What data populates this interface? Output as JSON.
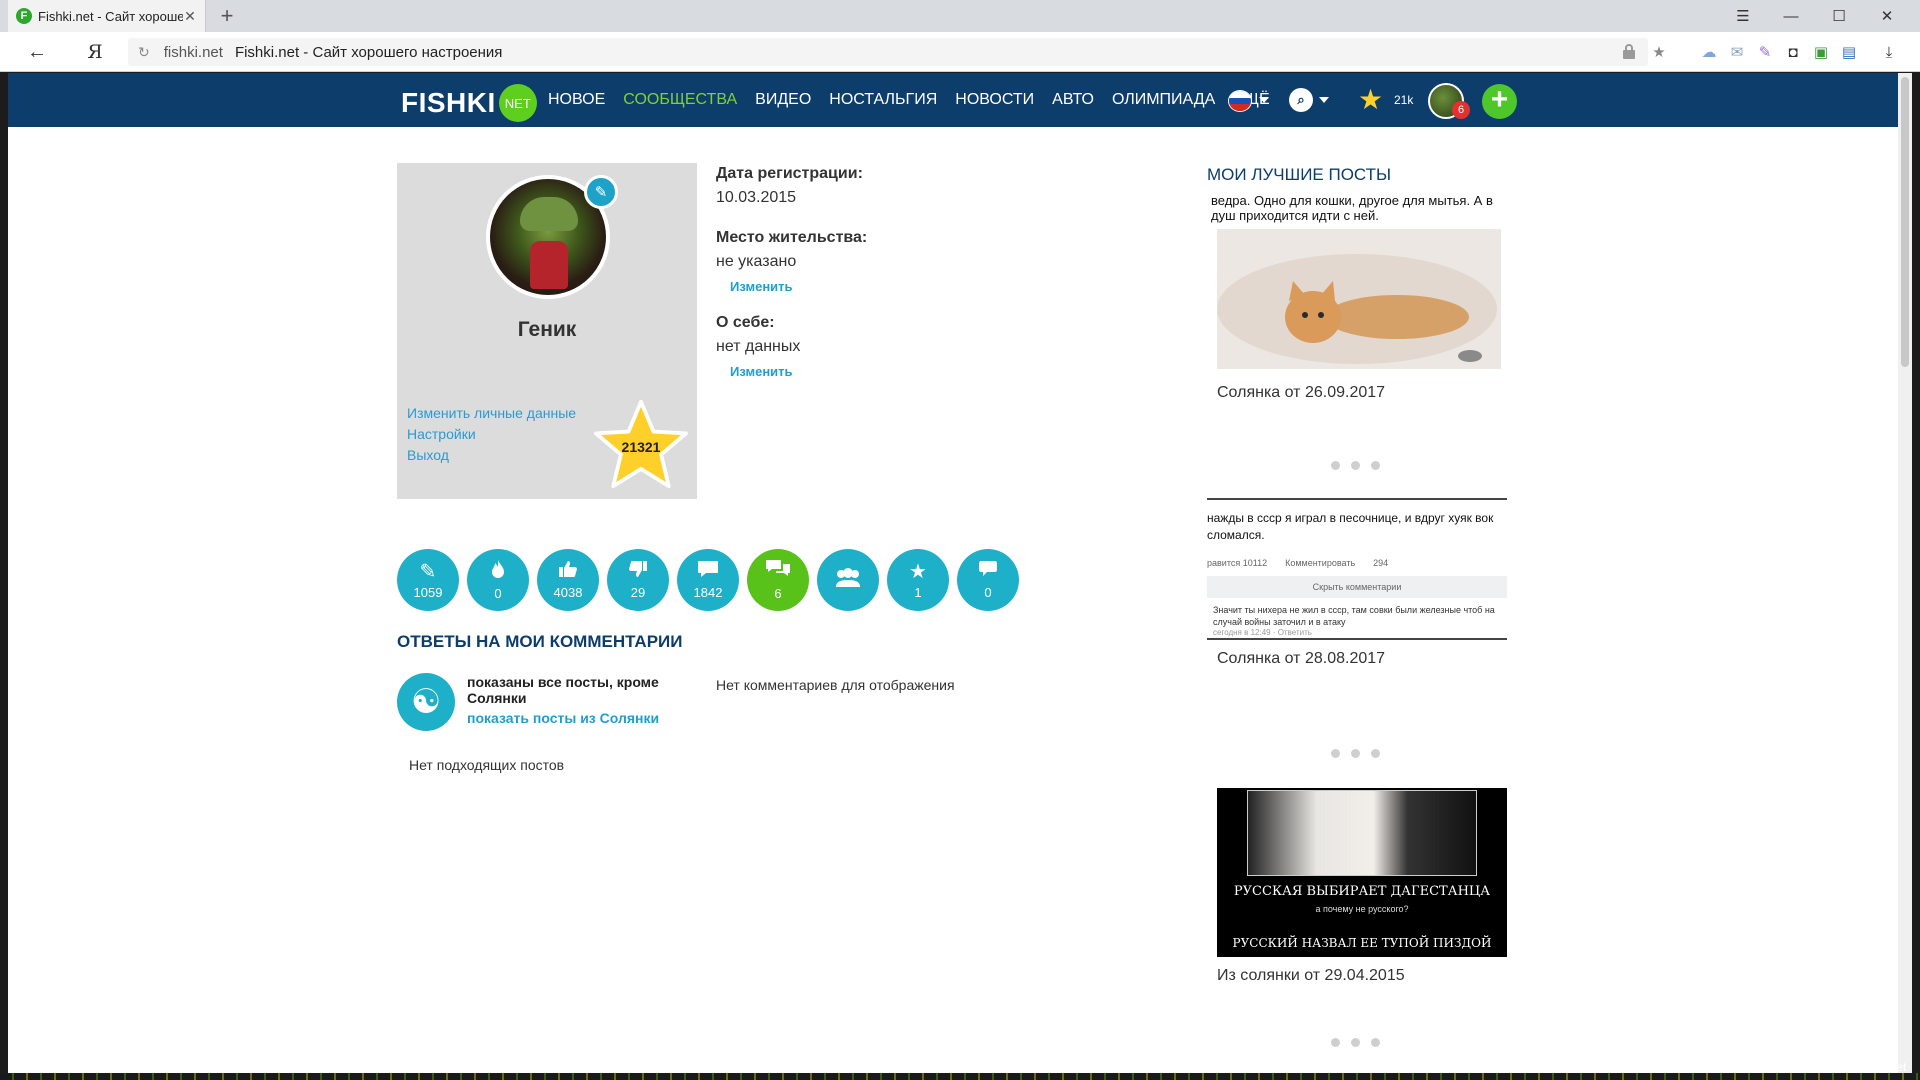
{
  "browser": {
    "tab_title": "Fishki.net - Сайт хорошего настроения",
    "tab_favicon": "F",
    "tab_close": "✕",
    "new_tab": "+",
    "window_controls": [
      "☰",
      "—",
      "☐",
      "✕"
    ],
    "back": "←",
    "yandex_logo": "Я",
    "reload": "↻",
    "url_host": "fishki.net",
    "url_title": "Fishki.net - Сайт хорошего настроения",
    "icons": [
      "lock-icon",
      "star-bookmark-icon",
      "cloud-icon",
      "mail-icon",
      "pen-icon",
      "pocket-icon",
      "counter-icon",
      "translate-icon",
      "download-icon"
    ]
  },
  "site": {
    "logo": "FISHKI",
    "logo_badge": "NET",
    "menu": [
      {
        "label": "НОВОЕ",
        "active": false
      },
      {
        "label": "СООБЩЕСТВА",
        "active": true
      },
      {
        "label": "ВИДЕО",
        "active": false
      },
      {
        "label": "НОСТАЛЬГИЯ",
        "active": false
      },
      {
        "label": "НОВОСТИ",
        "active": false
      },
      {
        "label": "АВТО",
        "active": false
      },
      {
        "label": "ОЛИМПИАДА",
        "active": false
      },
      {
        "label": "ЕЩЁ",
        "active": false
      }
    ],
    "stars_count": "21k",
    "notifications": "6",
    "search_glyph": "⌕",
    "plus": "+"
  },
  "profile": {
    "name": "Геник",
    "links": [
      "Изменить личные данные",
      "Настройки",
      "Выход"
    ],
    "rating": "21321",
    "reg_label": "Дата регистрации:",
    "reg_value": "10.03.2015",
    "place_label": "Место жительства:",
    "place_value": "не указано",
    "about_label": "О себе:",
    "about_value": "нет данных",
    "edit_label": "Изменить"
  },
  "stats": [
    {
      "icon": "pen-icon",
      "glyph": "✎",
      "value": "1059",
      "green": false
    },
    {
      "icon": "fire-icon",
      "glyph": "🔥",
      "value": "0",
      "green": false
    },
    {
      "icon": "thumbs-up-icon",
      "glyph": "👍",
      "value": "4038",
      "green": false
    },
    {
      "icon": "thumbs-down-icon",
      "glyph": "👎",
      "value": "29",
      "green": false
    },
    {
      "icon": "comment-icon",
      "glyph": "💬",
      "value": "1842",
      "green": false
    },
    {
      "icon": "comments-icon",
      "glyph": "💬",
      "value": "6",
      "green": true
    },
    {
      "icon": "users-icon",
      "glyph": "👥",
      "value": "",
      "green": false
    },
    {
      "icon": "star-icon",
      "glyph": "★",
      "value": "1",
      "green": false
    },
    {
      "icon": "message-icon",
      "glyph": "💬",
      "value": "0",
      "green": false
    }
  ],
  "replies": {
    "title": "ОТВЕТЫ НА МОИ КОММЕНТАРИИ",
    "filter_text": "показаны все посты, кроме Солянки",
    "filter_link": "показать посты из Солянки",
    "no_comments": "Нет комментариев для отображения",
    "no_posts": "Нет подходящих постов"
  },
  "best_posts": {
    "title": "МОИ ЛУЧШИЕ ПОСТЫ",
    "post1": {
      "caption": "ведра. Одно для кошки, другое для мытья. А в душ приходится идти с ней.",
      "title": "Солянка от 26.09.2017"
    },
    "post2": {
      "caption": "нажды в ссср я играл в песочнице, и вдруг хуяк вок сломался.",
      "meta1": "равится 10112",
      "meta2": "Комментировать",
      "meta3": "294",
      "hide": "Скрыть комментарии",
      "comment": "Значит ты нихера не жил в ссср, там совки были железные чтоб на случай войны заточил и в атаку",
      "comment_meta": "сегодня в 12:49 · Ответить",
      "title": "Солянка от 28.08.2017"
    },
    "post3": {
      "line1": "РУССКАЯ ВЫБИРАЕТ ДАГЕСТАНЦА",
      "line2": "а почему не русского?",
      "line3": "РУССКИЙ НАЗВАЛ ЕЕ ТУПОЙ ПИЗДОЙ",
      "title": "Из солянки от 29.04.2015"
    }
  },
  "watermark": "Fishki.net"
}
